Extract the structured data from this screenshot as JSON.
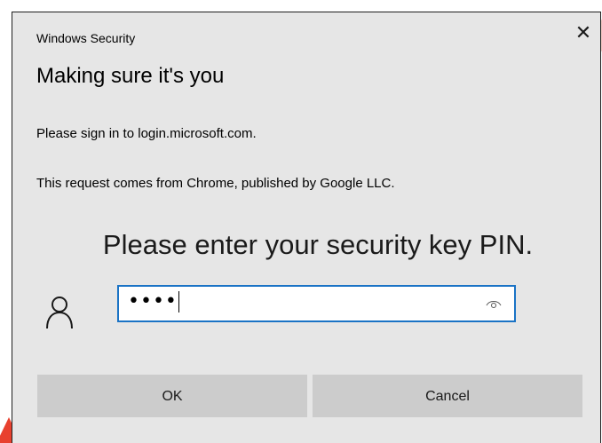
{
  "window": {
    "title": "Windows Security",
    "close_glyph": "✕"
  },
  "dialog": {
    "heading": "Making sure it's you",
    "sign_in_text": "Please sign in to login.microsoft.com.",
    "request_text": "This request comes from Chrome, published by Google LLC.",
    "prompt": "Please enter your security key PIN."
  },
  "pin_field": {
    "value": "••••",
    "reveal_icon": "eye-icon"
  },
  "user_icon": "user-icon",
  "buttons": {
    "ok_label": "OK",
    "cancel_label": "Cancel"
  },
  "colors": {
    "dialog_bg": "#e6e6e6",
    "button_bg": "#cccccc",
    "focus_border": "#1a73c5"
  }
}
